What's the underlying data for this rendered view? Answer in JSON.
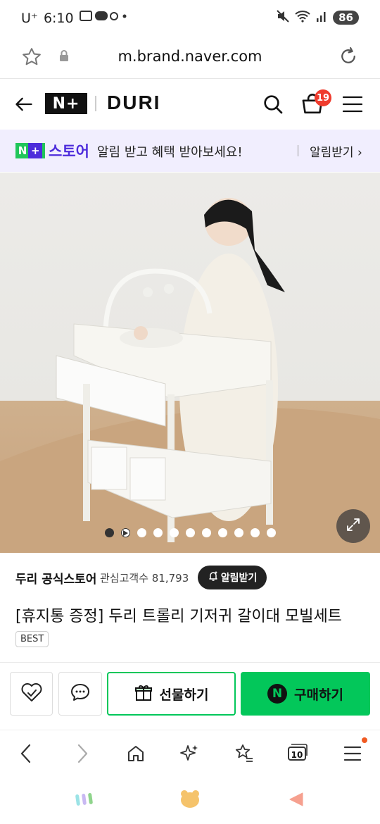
{
  "status_bar": {
    "carrier": "U⁺",
    "time": "6:10",
    "battery": "86"
  },
  "url_bar": {
    "url": "m.brand.naver.com"
  },
  "header": {
    "logo": "N+",
    "brand": "DURI",
    "cart_count": "19"
  },
  "promo": {
    "logo_n": "N",
    "logo_plus": "+",
    "store_label": "스토어",
    "message": "알림 받고 혜택 받아보세요!",
    "cta": "알림받기 ›"
  },
  "hero": {
    "slide_count": 11,
    "active_slide": 1
  },
  "product": {
    "store_name": "두리 공식스토어",
    "followers": "관심고객수 81,793",
    "alarm_label": "알림받기",
    "title": "[휴지통 증정] 두리 트롤리 기저귀 갈이대 모빌세트",
    "badge": "BEST"
  },
  "actions": {
    "gift_label": "선물하기",
    "buy_label": "구매하기",
    "buy_n": "N"
  },
  "browser_nav": {
    "tab_count": "10"
  },
  "colors": {
    "naver_green": "#03c75a",
    "store_purple": "#4d2cdb",
    "badge_red": "#ef3b2d"
  }
}
